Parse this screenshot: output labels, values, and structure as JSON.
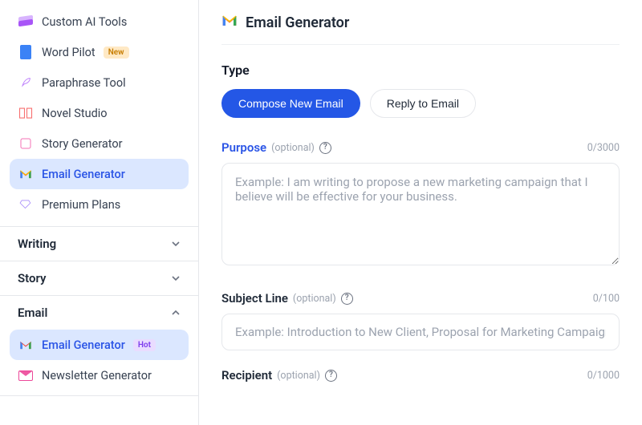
{
  "sidebar": {
    "items": [
      {
        "label": "Custom AI Tools",
        "icon": "layers-icon",
        "color1": "#a855f7",
        "color2": "#d8b4fe"
      },
      {
        "label": "Word Pilot",
        "icon": "document-icon",
        "color1": "#3b82f6",
        "badge": "New",
        "badgeKind": "new"
      },
      {
        "label": "Paraphrase Tool",
        "icon": "feather-icon",
        "color1": "#c084fc"
      },
      {
        "label": "Novel Studio",
        "icon": "book-icon",
        "color1": "#f87171"
      },
      {
        "label": "Story Generator",
        "icon": "story-icon",
        "color1": "#f472b6"
      },
      {
        "label": "Email Generator",
        "icon": "gmail-icon",
        "active": true
      },
      {
        "label": "Premium Plans",
        "icon": "gem-icon",
        "color1": "#a78bfa"
      }
    ],
    "sections": {
      "writing": {
        "title": "Writing",
        "expanded": false
      },
      "story": {
        "title": "Story",
        "expanded": false
      },
      "email": {
        "title": "Email",
        "expanded": true,
        "items": [
          {
            "label": "Email Generator",
            "icon": "gmail-icon",
            "active": true,
            "badge": "Hot",
            "badgeKind": "hot"
          },
          {
            "label": "Newsletter Generator",
            "icon": "mail-icon"
          }
        ]
      }
    }
  },
  "main": {
    "title": "Email Generator",
    "type": {
      "label": "Type",
      "options": {
        "compose": "Compose New Email",
        "reply": "Reply to Email"
      },
      "selected": "compose"
    },
    "fields": {
      "purpose": {
        "label": "Purpose",
        "optional": "(optional)",
        "counter": "0/3000",
        "placeholder": "Example: I am writing to propose a new marketing campaign that I believe will be effective for your business.",
        "value": ""
      },
      "subject": {
        "label": "Subject Line",
        "optional": "(optional)",
        "counter": "0/100",
        "placeholder": "Example: Introduction to New Client, Proposal for Marketing Campaign",
        "value": ""
      },
      "recipient": {
        "label": "Recipient",
        "optional": "(optional)",
        "counter": "0/1000"
      }
    }
  }
}
